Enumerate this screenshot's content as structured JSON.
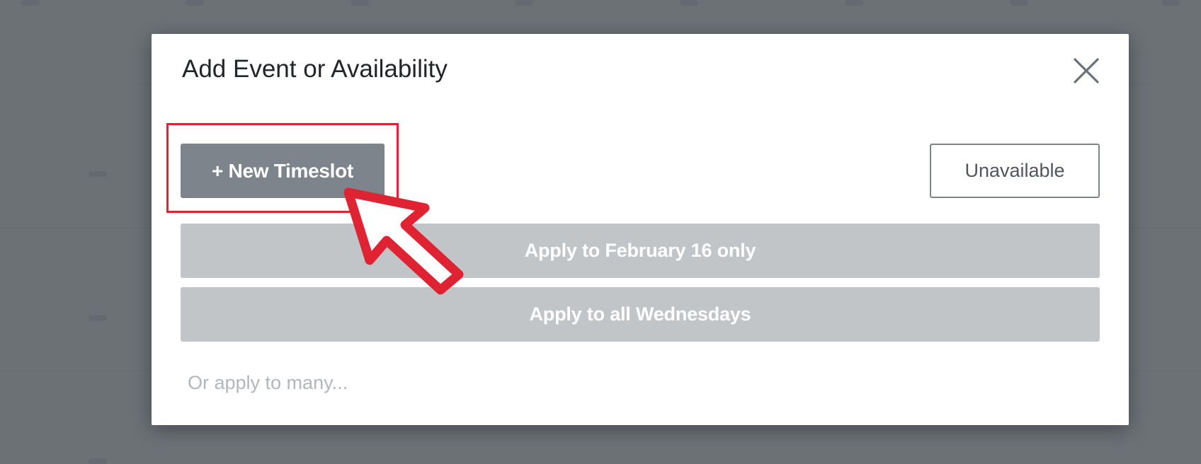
{
  "modal": {
    "title": "Add Event or Availability",
    "close_icon": "close-icon",
    "new_timeslot_label": "+ New Timeslot",
    "unavailable_label": "Unavailable",
    "apply_date_label": "Apply to February 16 only",
    "apply_weekday_label": "Apply to all Wednesdays",
    "apply_many_label": "Or apply to many..."
  },
  "annotation": {
    "highlight_color": "#e02333",
    "pointer_icon": "hand-cursor-icon"
  },
  "colors": {
    "primary_button": "#7d848b",
    "disabled_button": "#c2c5c8",
    "backdrop": "#6c7176"
  }
}
